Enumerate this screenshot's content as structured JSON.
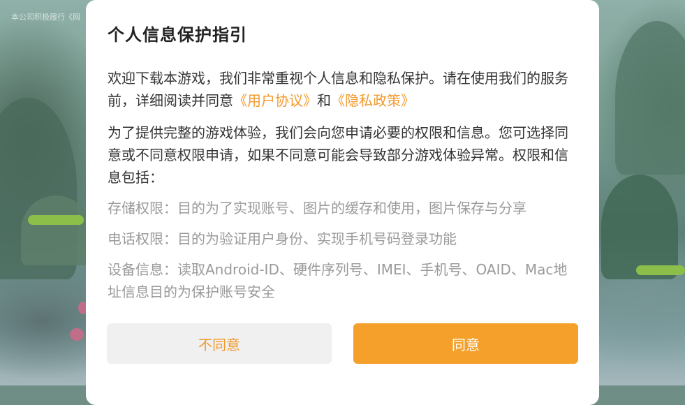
{
  "background": {
    "notice_text": "本公司积极履行《网"
  },
  "dialog": {
    "title": "个人信息保护指引",
    "intro": {
      "text_before": "欢迎下载本游戏，我们非常重视个人信息和隐私保护。请在使用我们的服务前，详细阅读并同意",
      "user_agreement_link": "《用户协议》",
      "and_text": "和",
      "privacy_policy_link": "《隐私政策》"
    },
    "permissions_intro": "为了提供完整的游戏体验，我们会向您申请必要的权限和信息。您可选择同意或不同意权限申请，如果不同意可能会导致部分游戏体验异常。权限和信息包括：",
    "permissions": [
      {
        "text": "存储权限：目的为了实现账号、图片的缓存和使用，图片保存与分享"
      },
      {
        "text": "电话权限：目的为验证用户身份、实现手机号码登录功能"
      },
      {
        "text": "设备信息：读取Android-ID、硬件序列号、IMEI、手机号、OAID、Mac地址信息目的为保护账号安全"
      }
    ],
    "buttons": {
      "disagree": "不同意",
      "agree": "同意"
    }
  },
  "colors": {
    "accent": "#f4a02b",
    "link": "#f29a2e",
    "secondary_text": "#9a9a9a"
  }
}
